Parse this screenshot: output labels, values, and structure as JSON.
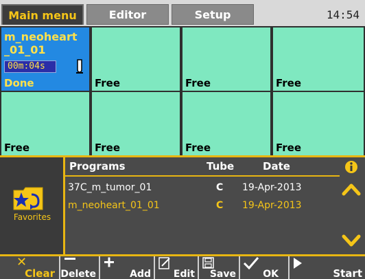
{
  "tabs": [
    {
      "label": "Main menu",
      "active": true
    },
    {
      "label": "Editor",
      "active": false
    },
    {
      "label": "Setup",
      "active": false
    }
  ],
  "clock": "14:54",
  "slots": {
    "program": {
      "name_line1": "m_neoheart",
      "name_line2": "_01_01",
      "timer": "00m:04s",
      "status": "Done"
    },
    "free_label": "Free"
  },
  "favorites": {
    "label": "Favorites"
  },
  "programs_table": {
    "headers": {
      "programs": "Programs",
      "tube": "Tube",
      "date": "Date"
    },
    "rows": [
      {
        "name": "37C_m_tumor_01",
        "tube": "C",
        "date": "19-Apr-2013",
        "selected": false
      },
      {
        "name": "m_neoheart_01_01",
        "tube": "C",
        "date": "19-Apr-2013",
        "selected": true
      }
    ]
  },
  "toolbar": {
    "clear": "Clear",
    "delete": "Delete",
    "add": "Add",
    "edit": "Edit",
    "save": "Save",
    "ok": "OK",
    "start": "Start"
  },
  "colors": {
    "accent": "#f5c518",
    "free_slot": "#7fe8c0",
    "active_slot": "#2389e2"
  }
}
